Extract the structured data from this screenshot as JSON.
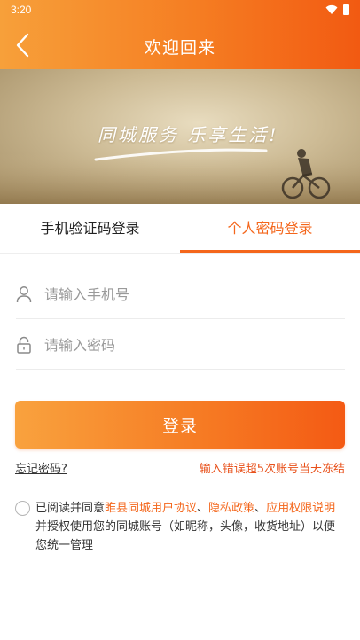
{
  "status_bar": {
    "time": "3:20"
  },
  "header": {
    "title": "欢迎回来"
  },
  "banner": {
    "slogan": "同城服务 乐享生活!"
  },
  "tabs": [
    {
      "label": "手机验证码登录",
      "active": false
    },
    {
      "label": "个人密码登录",
      "active": true
    }
  ],
  "form": {
    "phone_placeholder": "请输入手机号",
    "password_placeholder": "请输入密码",
    "login_label": "登录",
    "forgot_label": "忘记密码?",
    "freeze_notice": "输入错误超5次账号当天冻结"
  },
  "agreement": {
    "prefix": "已阅读并同意",
    "user_agreement": "睢县同城用户协议",
    "sep1": "、",
    "privacy": "隐私政策",
    "sep2": "、",
    "permission": "应用权限说明",
    "suffix": "并授权使用您的同城账号（如昵称，头像，收货地址）以便您统一管理"
  },
  "colors": {
    "accent": "#f4661b",
    "header_start": "#f7a03a",
    "header_end": "#f25a12"
  }
}
